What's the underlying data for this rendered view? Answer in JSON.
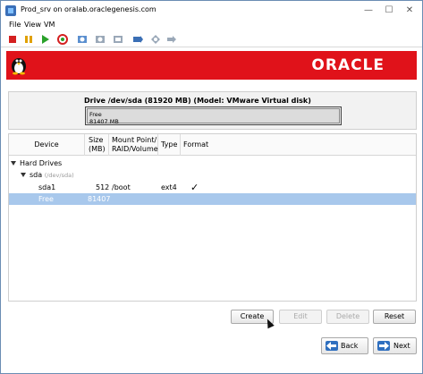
{
  "window": {
    "title": "Prod_srv on oralab.oraclegenesis.com"
  },
  "menu": {
    "items": [
      "File",
      "View",
      "VM"
    ]
  },
  "toolbar": {
    "icons": [
      "stop-icon",
      "pause-icon",
      "play-icon",
      "refresh-icon",
      "snapshot-icon",
      "snapshot-restore-icon",
      "snapshot-manage-icon",
      "usb-icon",
      "settings-icon",
      "forward-icon"
    ]
  },
  "banner": {
    "logo_text": "ORACLE"
  },
  "drive": {
    "title": "Drive /dev/sda (81920 MB) (Model: VMware Virtual disk)",
    "free_label": "Free",
    "free_size": "81407 MB"
  },
  "table": {
    "headers": {
      "device": "Device",
      "size": "Size\n(MB)",
      "mount": "Mount Point/\nRAID/Volume",
      "type": "Type",
      "format": "Format"
    },
    "group_label": "Hard Drives",
    "disk_label": "sda",
    "disk_path": "(/dev/sda)",
    "rows": [
      {
        "device": "sda1",
        "size": "512",
        "mount": "/boot",
        "type": "ext4",
        "format": "✓"
      },
      {
        "device": "Free",
        "size": "81407",
        "mount": "",
        "type": "",
        "format": ""
      }
    ]
  },
  "actions": {
    "create": "Create",
    "edit": "Edit",
    "delete": "Delete",
    "reset": "Reset"
  },
  "nav": {
    "back": "Back",
    "next": "Next"
  }
}
